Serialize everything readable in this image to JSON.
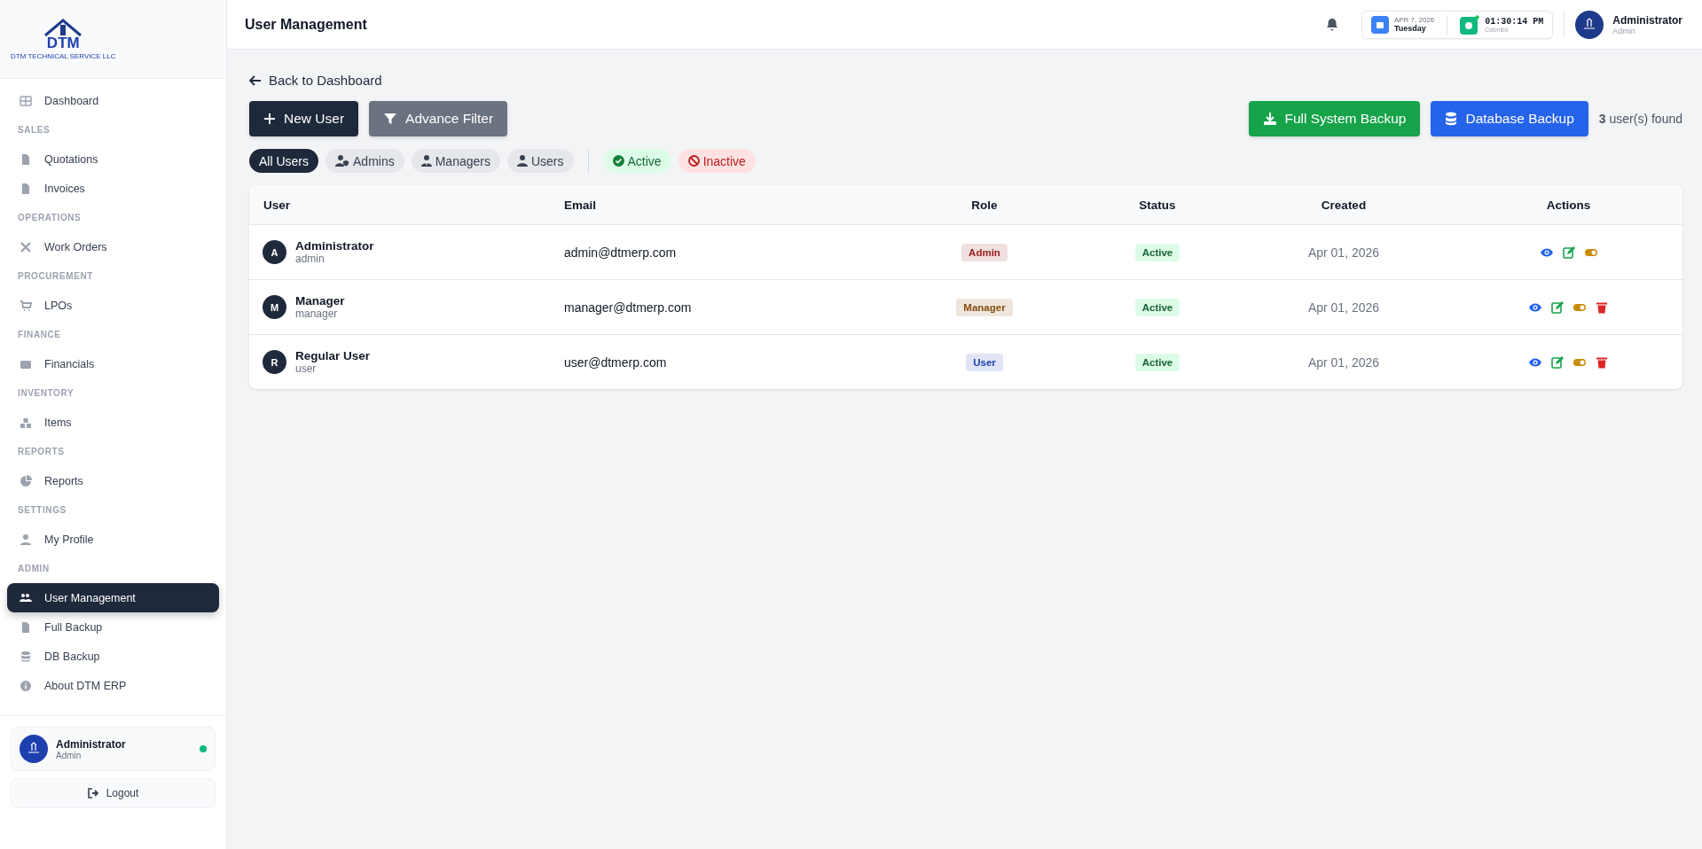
{
  "sidebar": {
    "logo": {
      "mark": "DTM",
      "caption": "DTM TECHNICAL SERVICE LLC"
    },
    "nav": [
      {
        "kind": "item",
        "label": "Dashboard",
        "selected": false
      },
      {
        "kind": "section",
        "label": "SALES"
      },
      {
        "kind": "item",
        "label": "Quotations",
        "selected": false
      },
      {
        "kind": "item",
        "label": "Invoices",
        "selected": false
      },
      {
        "kind": "section",
        "label": "OPERATIONS"
      },
      {
        "kind": "item",
        "label": "Work Orders",
        "selected": false
      },
      {
        "kind": "section",
        "label": "PROCUREMENT"
      },
      {
        "kind": "item",
        "label": "LPOs",
        "selected": false
      },
      {
        "kind": "section",
        "label": "FINANCE"
      },
      {
        "kind": "item",
        "label": "Financials",
        "selected": false
      },
      {
        "kind": "section",
        "label": "INVENTORY"
      },
      {
        "kind": "item",
        "label": "Items",
        "selected": false
      },
      {
        "kind": "section",
        "label": "REPORTS"
      },
      {
        "kind": "item",
        "label": "Reports",
        "selected": false
      },
      {
        "kind": "section",
        "label": "SETTINGS"
      },
      {
        "kind": "item",
        "label": "My Profile",
        "selected": false
      },
      {
        "kind": "section",
        "label": "ADMIN"
      },
      {
        "kind": "item",
        "label": "User Management",
        "selected": true
      },
      {
        "kind": "item",
        "label": "Full Backup",
        "selected": false
      },
      {
        "kind": "item",
        "label": "DB Backup",
        "selected": false
      },
      {
        "kind": "item",
        "label": "About DTM ERP",
        "selected": false
      }
    ],
    "user": {
      "name": "Administrator",
      "role": "Admin",
      "online": true
    },
    "logout": "Logout"
  },
  "header": {
    "title": "User Management",
    "date": "APR 7, 2026",
    "day": "Tuesday",
    "time": "01:30:14 PM",
    "city": "Colombo",
    "user": {
      "name": "Administrator",
      "role": "Admin"
    }
  },
  "back_link": "Back to Dashboard",
  "toolbar": {
    "new_user": "New User",
    "advance_filter": "Advance Filter",
    "full_backup": "Full System Backup",
    "db_backup": "Database Backup",
    "count": "3",
    "count_label": "user(s) found"
  },
  "filters": [
    {
      "kind": "all",
      "label": "All Users",
      "selected": true
    },
    {
      "kind": "admins",
      "label": "Admins",
      "selected": false
    },
    {
      "kind": "managers",
      "label": "Managers",
      "selected": false
    },
    {
      "kind": "users",
      "label": "Users",
      "selected": false
    },
    {
      "kind": "active",
      "label": "Active",
      "selected": false
    },
    {
      "kind": "inactive",
      "label": "Inactive",
      "selected": false
    }
  ],
  "table": {
    "columns": [
      "User",
      "Email",
      "Role",
      "Status",
      "Created",
      "Actions"
    ],
    "rows": [
      {
        "initial": "A",
        "name": "Administrator",
        "username": "admin",
        "email": "admin@dtmerp.com",
        "role": "Admin",
        "color": "#991b1b",
        "status": "Active",
        "created": "Apr 01, 2026",
        "deletable": false
      },
      {
        "initial": "M",
        "name": "Manager",
        "username": "manager",
        "email": "manager@dtmerp.com",
        "role": "Manager",
        "color": "#854d0e",
        "status": "Active",
        "created": "Apr 01, 2026",
        "deletable": true
      },
      {
        "initial": "R",
        "name": "Regular User",
        "username": "user",
        "email": "user@dtmerp.com",
        "role": "User",
        "color": "#1e40af",
        "status": "Active",
        "created": "Apr 01, 2026",
        "deletable": true
      }
    ]
  }
}
